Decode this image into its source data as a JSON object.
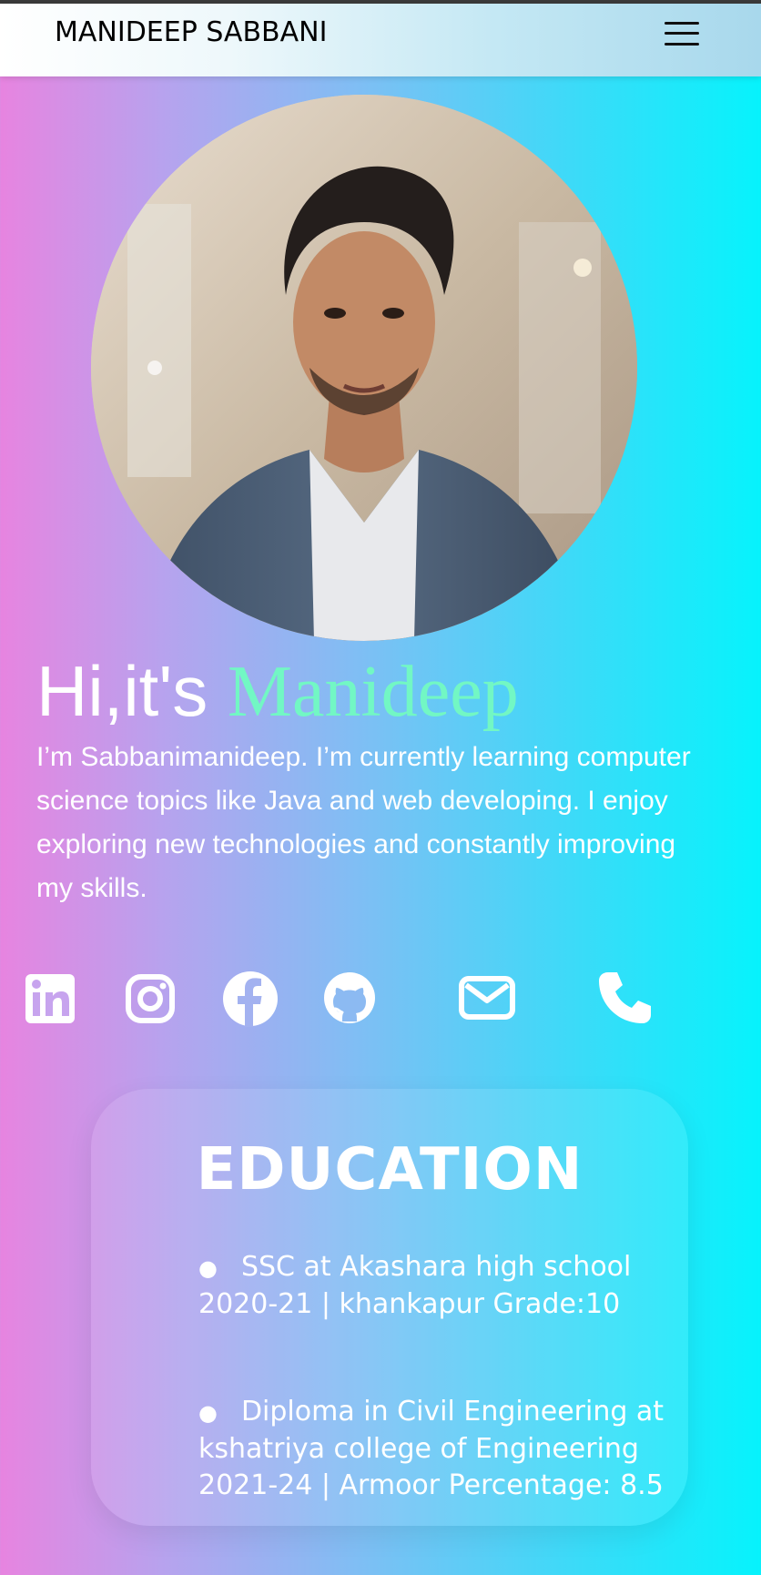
{
  "navbar": {
    "brand": "MANIDEEP SABBANI",
    "menu_icon": "hamburger-menu-icon"
  },
  "hero": {
    "greeting": "Hi,it's ",
    "name": "Manideep",
    "bio": "I’m Sabbanimanideep. I’m currently learning computer science topics like Java and web developing. I enjoy exploring new technologies and constantly improving my skills."
  },
  "socials": [
    {
      "icon": "linkedin-icon"
    },
    {
      "icon": "instagram-icon"
    },
    {
      "icon": "facebook-icon"
    },
    {
      "icon": "github-icon"
    },
    {
      "icon": "email-icon"
    },
    {
      "icon": "phone-icon"
    }
  ],
  "education": {
    "title": "EDUCATION",
    "items": [
      {
        "text": "SSC at Akashara high school 2020-21 | khankapur Grade:10"
      },
      {
        "text": "Diploma in Civil Engineering at kshatriya college of Engineering 2021-24 | Armoor Percentage: 8.5"
      }
    ]
  },
  "colors": {
    "accent_name": "#72f7c4",
    "gradient_left": "#e784e0",
    "gradient_right": "#06f3fc"
  }
}
